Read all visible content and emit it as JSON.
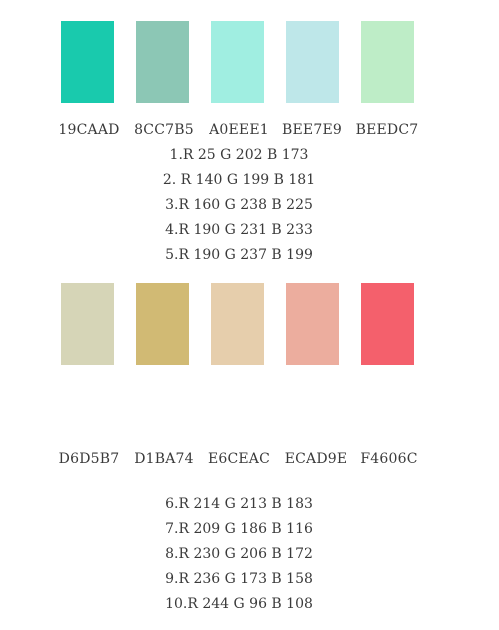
{
  "palette_top": {
    "swatches": [
      {
        "hex": "19CAAD",
        "color": "#19CAAD"
      },
      {
        "hex": "8CC7B5",
        "color": "#8CC7B5"
      },
      {
        "hex": "A0EEE1",
        "color": "#A0EEE1"
      },
      {
        "hex": "BEE7E9",
        "color": "#BEE7E9"
      },
      {
        "hex": "BEEDC7",
        "color": "#BEEDC7"
      }
    ],
    "rgb_lines": [
      "1.R 25 G 202 B 173",
      "2. R 140 G 199 B 181",
      "3.R 160 G 238 B 225",
      "4.R 190 G 231 B 233",
      "5.R 190 G 237 B 199"
    ]
  },
  "palette_bottom": {
    "swatches": [
      {
        "hex": "D6D5B7",
        "color": "#D6D5B7"
      },
      {
        "hex": "D1BA74",
        "color": "#D1BA74"
      },
      {
        "hex": "E6CEAC",
        "color": "#E6CEAC"
      },
      {
        "hex": "ECAD9E",
        "color": "#ECAD9E"
      },
      {
        "hex": "F4606C",
        "color": "#F4606C"
      }
    ],
    "rgb_lines": [
      "6.R 214 G 213 B 183",
      "7.R 209 G 186 B 116",
      "8.R 230 G 206 B 172",
      "9.R 236 G 173 B 158",
      "10.R 244 G 96 B 108"
    ]
  }
}
